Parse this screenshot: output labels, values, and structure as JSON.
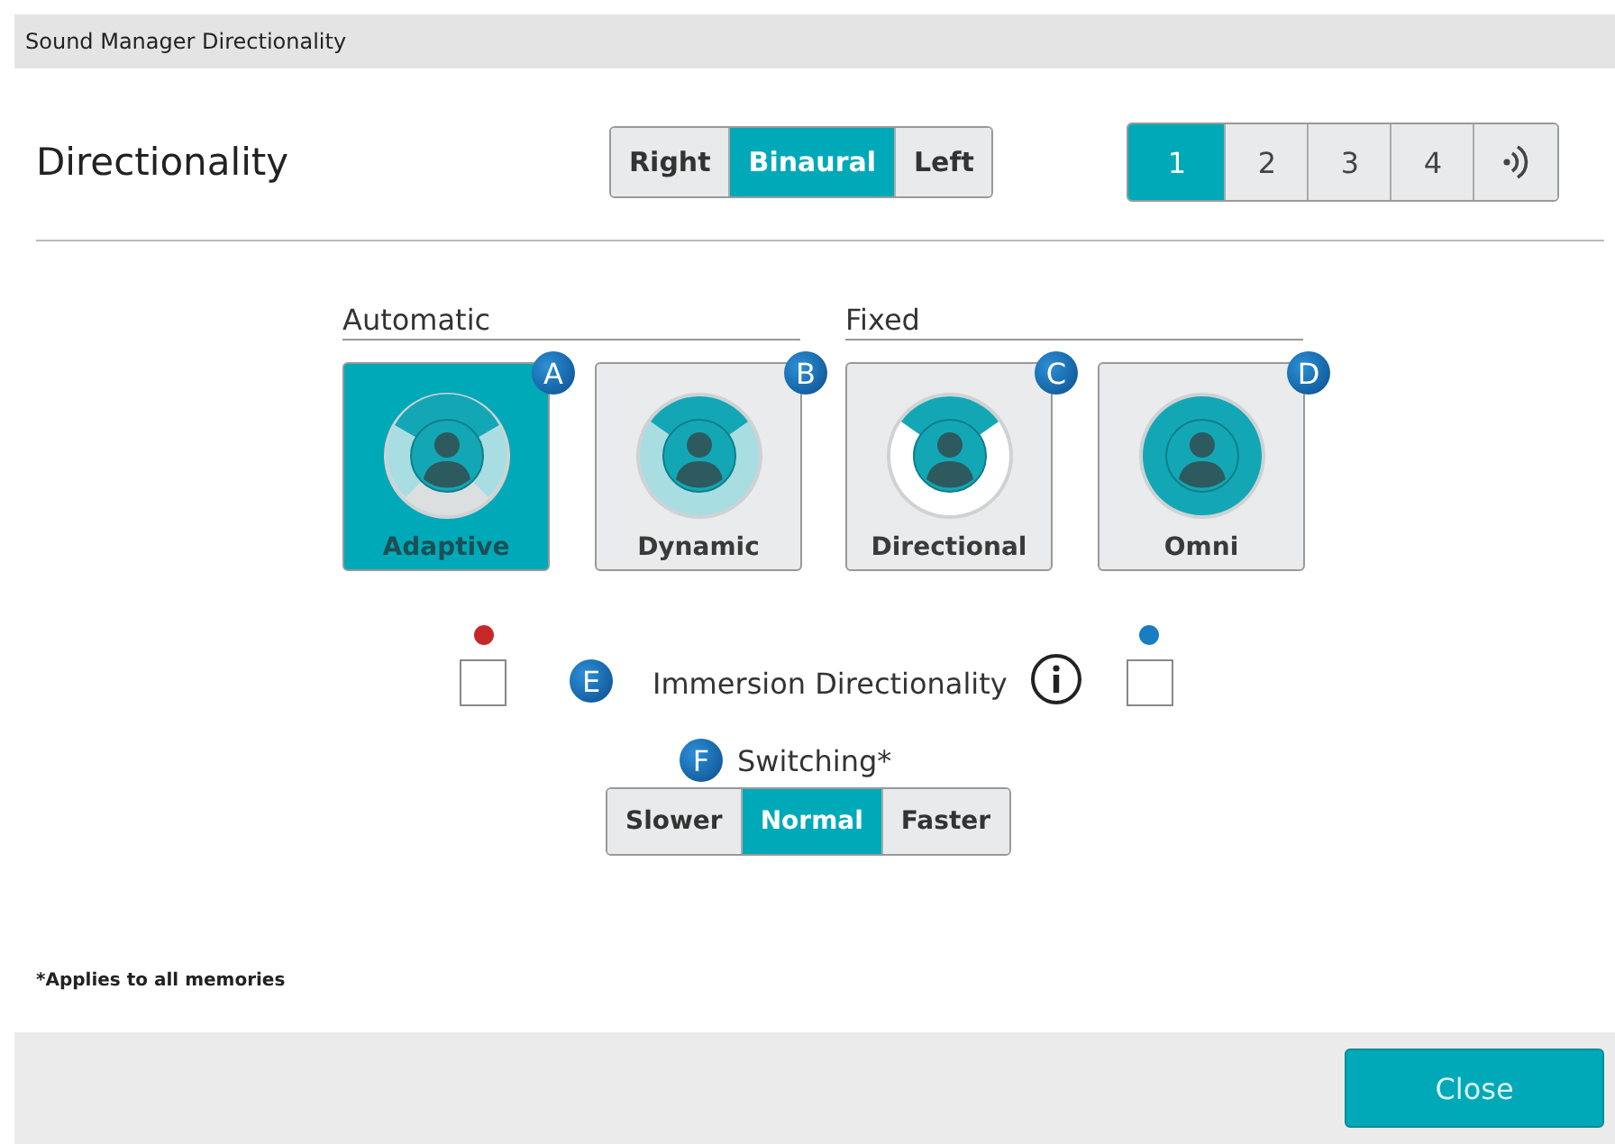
{
  "window": {
    "title": "Sound Manager Directionality"
  },
  "heading": "Directionality",
  "sides": [
    {
      "label": "Right",
      "selected": false
    },
    {
      "label": "Binaural",
      "selected": true
    },
    {
      "label": "Left",
      "selected": false
    }
  ],
  "memories": [
    {
      "label": "1",
      "selected": true
    },
    {
      "label": "2",
      "selected": false
    },
    {
      "label": "3",
      "selected": false
    },
    {
      "label": "4",
      "selected": false
    }
  ],
  "streaming_tab": {
    "selected": false
  },
  "mode_groups": [
    {
      "title": "Automatic",
      "modes": [
        {
          "label": "Adaptive",
          "badge": "A",
          "kind": "adaptive",
          "selected": true
        },
        {
          "label": "Dynamic",
          "badge": "B",
          "kind": "dynamic",
          "selected": false
        }
      ]
    },
    {
      "title": "Fixed",
      "modes": [
        {
          "label": "Directional",
          "badge": "C",
          "kind": "directional",
          "selected": false
        },
        {
          "label": "Omni",
          "badge": "D",
          "kind": "omni",
          "selected": false
        }
      ]
    }
  ],
  "immersion": {
    "label": "Immersion Directionality",
    "badge": "E",
    "checkboxes": [
      {
        "color": "#c62828",
        "checked": false
      },
      {
        "color": "#1a7dc4",
        "checked": false
      }
    ]
  },
  "switching": {
    "label": "Switching*",
    "badge": "F",
    "options": [
      {
        "label": "Slower",
        "selected": false
      },
      {
        "label": "Normal",
        "selected": true
      },
      {
        "label": "Faster",
        "selected": false
      }
    ]
  },
  "footnote": "*Applies to all memories",
  "close_button": "Close"
}
